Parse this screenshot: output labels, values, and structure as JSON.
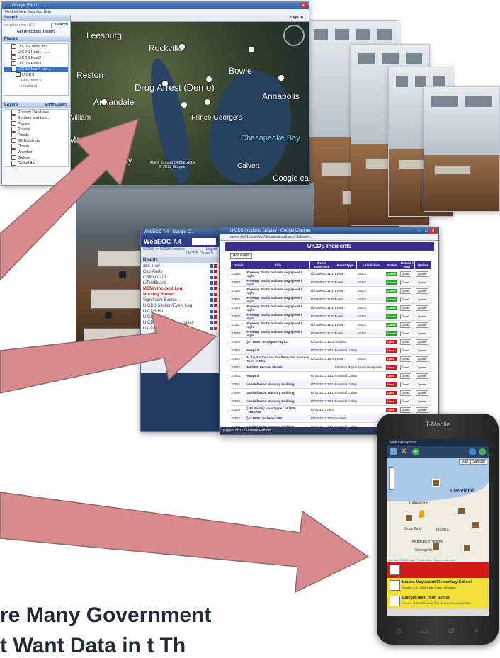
{
  "google_earth": {
    "title": "Google Earth",
    "menu": "File  Edit  View  Tools  Add  Help",
    "search_header": "Search",
    "search_placeholder": "ex: pizza near NYC",
    "search_button": "Search",
    "directions_link": "Get Directions",
    "history_link": "History",
    "places_header": "Places",
    "places": [
      "UICDS Test2 Incl...",
      "UICDS Host1 - L...",
      "UICDS Host2",
      "UICDS Host3",
      "UICDS host4 Incl...",
      "UICDS",
      "Returned 30",
      "results at"
    ],
    "layers_header": "Layers",
    "earth_gallery": "Earth Gallery",
    "layers": [
      "Primary Database",
      "Borders and Lab...",
      "Places",
      "Photos",
      "Roads",
      "3D Buildings",
      "Ocean",
      "Weather",
      "Gallery",
      "Global Aw..."
    ],
    "sign_in": "Sign In",
    "map_labels": {
      "leesburg": "Leesburg",
      "rockville": "Rockville",
      "bowie": "Bowie",
      "annapolis": "Annapolis",
      "reston": "Reston",
      "drug_arrest": "Drug Arrest (Demo)",
      "annandale": "Annandale",
      "manassas": "Manassas",
      "william": "William",
      "prince_georges": "Prince George's",
      "chesapeake": "Chesapeake Bay",
      "city": "City",
      "calvert": "Calvert",
      "stafford": "afford",
      "google": "Google ea",
      "copyright": "Image © 2012 DigitalGlobe\n© 2012 Google"
    }
  },
  "webeoc": {
    "title": "WebEOC 7.4 - Google C...",
    "brand": "WebEOC 7.4",
    "breadcrumb": "UICDS >> UICDS Incident",
    "logout": "Log off",
    "demo_link": "UICDS Demo 5",
    "boards_header": "Boards",
    "boards": [
      "abc_new",
      "Cap Alerts",
      "CBP UICDS",
      "LiTestBoard",
      "MEMA Incident Log",
      "Nursing Homes",
      "Significant Events",
      "UICDS Section/Event Log",
      "UICDS Ho...",
      "UICDS Incid...",
      "UICDS Incide...",
      "UICDS Incide..."
    ],
    "boards_display": "...isplay",
    "highlighted_boards": [
      "MEMA Incident Log",
      "Nursing Homes"
    ]
  },
  "uicds": {
    "title": "UICDS Incidents Display - Google Chrome",
    "address": "demo.wp911.com/wc7/boards/board.aspx?tableid=...",
    "heading": "UICDS Incidents",
    "add_event": "Add Event",
    "columns": [
      "Dataid",
      "Title",
      "Event Date/Time",
      "Event Type",
      "Jurisdiction",
      "Status",
      "Details / Map",
      "Update"
    ],
    "rows": [
      {
        "id": "23630",
        "title": "Freeway Traffic Incident Avg speed 0 mph",
        "date": "11/08/2012 11:12:00",
        "type": "Event",
        "jur": "USGS",
        "status": "Closed"
      },
      {
        "id": "23628",
        "title": "Freeway Traffic Incident Avg speed 0 mph",
        "date": "11/08/2012 11:14:00",
        "type": "Event",
        "jur": "USGS",
        "status": "Closed"
      },
      {
        "id": "23626",
        "title": "Freeway Traffic Incident Avg speed 0 mph",
        "date": "11/08/2012 11:13:00",
        "type": "Event",
        "jur": "USGS",
        "status": "Closed"
      },
      {
        "id": "23625",
        "title": "Freeway Traffic Incident Avg speed 0 mph",
        "date": "11/08/2012 11:09:00",
        "type": "Event",
        "jur": "USGS",
        "status": "Closed"
      },
      {
        "id": "23624",
        "title": "Freeway Traffic Incident Avg speed 0 mph",
        "date": "11/08/2012 11:15:00",
        "type": "Event",
        "jur": "USGS",
        "status": "Closed"
      },
      {
        "id": "23623",
        "title": "Freeway Traffic Incident Avg speed 0 mph",
        "date": "11/08/2012 11:02:00",
        "type": "Event",
        "jur": "USGS",
        "status": "Closed"
      },
      {
        "id": "23621",
        "title": "Freeway Traffic Incident Avg speed 0 mph",
        "date": "11/08/2012 11:12:00",
        "type": "Event",
        "jur": "USGS",
        "status": "Closed"
      },
      {
        "id": "23620",
        "title": "Freeway Traffic Incident Avg speed 0 mph",
        "date": "11/08/2012 11:12:00",
        "type": "Event",
        "jur": "USGS",
        "status": "Closed"
      },
      {
        "id": "23566",
        "title": "[AT RISK] IcsAirportFlty.62",
        "date": "10/16/2012 12:55:45",
        "type": "Incident",
        "jur": "",
        "status": "Open"
      },
      {
        "id": "23565",
        "title": "Hospital",
        "date": "10/17/2012 13:10:00",
        "type": "Potential Collapse",
        "jur": "",
        "status": "Open"
      },
      {
        "id": "23561",
        "title": "M 7.0, Earthquake Southern San Andreas Fault (GGEx)",
        "date": "10/16/2012 12:00:00",
        "type": "Event",
        "jur": "USGS",
        "status": "Open"
      },
      {
        "id": "23513",
        "title": "NASA E Decider Models",
        "date": "",
        "type": "Situation Report",
        "jur": "SpotonResponse",
        "status": "Open"
      },
      {
        "id": "23563",
        "title": "Hospital",
        "date": "10/17/2012 13:10:00",
        "type": "Potential Collapse",
        "jur": "",
        "status": "Open"
      },
      {
        "id": "23562",
        "title": "Unreinforced Masonry Building",
        "date": "10/17/2012 13:10:00",
        "type": "Potential Collapse",
        "jur": "",
        "status": "Open"
      },
      {
        "id": "23560",
        "title": "Unreinforced Masonry Building",
        "date": "10/17/2012 13:10:00",
        "type": "Potential Collapse",
        "jur": "",
        "status": "Open"
      },
      {
        "id": "23559",
        "title": "Unreinforced Masonry Building",
        "date": "10/17/2012 13:10:00",
        "type": "Potential Collapse",
        "jur": "",
        "status": "Open"
      },
      {
        "id": "23558",
        "title": "[JPL NASA] Investigate: 34.2026, -118.1745",
        "date": "10/17/2012 09:41:00",
        "type": "",
        "jur": "",
        "status": "Open"
      },
      {
        "id": "23557",
        "title": "[AT RISK] IcsDemo.008",
        "date": "10/16/2012 12:55:30",
        "type": "Incident",
        "jur": "",
        "status": "Open"
      },
      {
        "id": "23556",
        "title": "Unreinforced Masonry Building",
        "date": "10/17/2012 13:10:00",
        "type": "Potential Collapse",
        "jur": "",
        "status": "Open"
      },
      {
        "id": "23555",
        "title": "Unreinforced Masonry Building",
        "date": "10/17/2012 13:10:00",
        "type": "Potential Collapse",
        "jur": "",
        "status": "Open"
      }
    ],
    "detail_label": "Detail",
    "update_label": "Update",
    "footer": "Page 9 of 122    Disable Refresh"
  },
  "phone": {
    "carrier": "T-Mobile",
    "app_title": "SpotOnResponse",
    "map_tab": "Map",
    "satellite_tab": "Satellite",
    "map_labels": [
      "Cleveland",
      "Lakewood",
      "Parma",
      "Brook Park",
      "Middleburg Heights",
      "Strongsville"
    ],
    "map_credit": "Map data ©2013 Google · Terms of Use · Report a map error",
    "items": [
      {
        "name": "Louisa May Alcott Elementary School",
        "detail": "Grades: K-8  10308 Baltic Road, Cleveland",
        "bg": "#f2df3a"
      },
      {
        "name": "Lincoln-West High School",
        "detail": "Grades: 9-12  3202 West 30th Street, Cleveland 44109",
        "bg": "#f2df3a"
      }
    ],
    "alert_color": "#d11a1a"
  },
  "caption": {
    "line1": "re Many Government",
    "line2": "t Want Data in t Th"
  },
  "colors": {
    "arrow_fill": "#d98a8e",
    "arrow_stroke": "#8a6a6a",
    "closed": "#1aa81a",
    "open": "#d41c1c",
    "uicds_purple": "#3a2f8f"
  }
}
